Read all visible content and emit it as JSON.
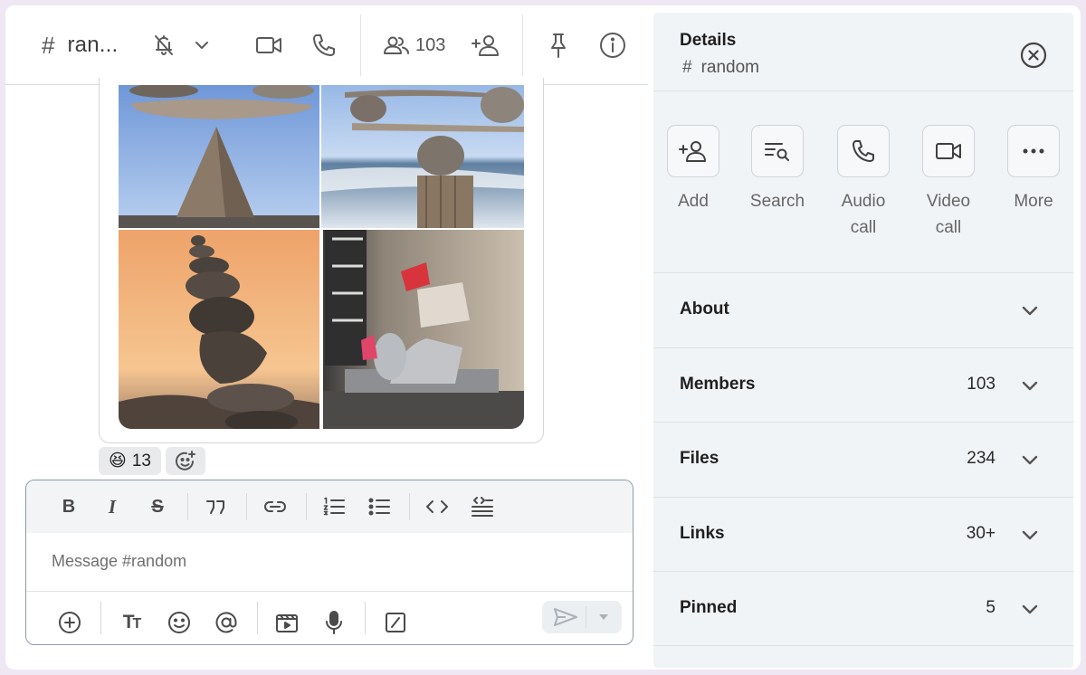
{
  "header": {
    "channel_name": "ran...",
    "member_count": "103",
    "icons": [
      "hash-icon",
      "bell-off-icon",
      "chevron-down-icon",
      "video-icon",
      "phone-icon",
      "members-icon",
      "add-user-icon",
      "pin-icon",
      "info-icon"
    ]
  },
  "message": {
    "images": [
      {
        "icon": "stacked-stones-balance-photo",
        "colors": {
          "sky": "#8fb4e8",
          "stone": "#8a7c6b"
        }
      },
      {
        "icon": "stones-on-post-ocean-photo",
        "colors": {
          "sky": "#a9c6ee",
          "sea": "#587b9c"
        }
      },
      {
        "icon": "stone-tower-sunset-photo",
        "colors": {
          "sky": "#f0a46a",
          "stone": "#4d4540"
        }
      },
      {
        "icon": "dish-rack-kitchen-photo",
        "colors": {
          "wall": "#c6b8a7",
          "accent": "#e0466a"
        }
      }
    ],
    "reactions": [
      {
        "emoji": "😆",
        "count": "13"
      },
      {
        "emoji": "add-reaction-icon",
        "count": ""
      }
    ]
  },
  "composer": {
    "placeholder": "Message #random",
    "format_tools": [
      "bold-icon",
      "italic-icon",
      "strikethrough-icon",
      "quote-icon",
      "link-icon",
      "numbered-list-icon",
      "bullet-list-icon",
      "code-icon",
      "code-block-icon"
    ],
    "bottom_tools": [
      "add-icon",
      "text-format-icon",
      "emoji-icon",
      "mention-icon",
      "video-clip-icon",
      "microphone-icon",
      "slash-command-icon",
      "send-icon",
      "send-options-icon"
    ]
  },
  "details": {
    "title": "Details",
    "channel": "random",
    "actions": [
      {
        "label": "Add",
        "icon": "add-user-icon"
      },
      {
        "label": "Search",
        "icon": "search-list-icon"
      },
      {
        "label": "Audio call",
        "icon": "phone-icon"
      },
      {
        "label": "Video call",
        "icon": "video-icon"
      },
      {
        "label": "More",
        "icon": "more-icon"
      }
    ],
    "sections": [
      {
        "label": "About",
        "count": ""
      },
      {
        "label": "Members",
        "count": "103"
      },
      {
        "label": "Files",
        "count": "234"
      },
      {
        "label": "Links",
        "count": "30+"
      },
      {
        "label": "Pinned",
        "count": "5"
      }
    ]
  }
}
